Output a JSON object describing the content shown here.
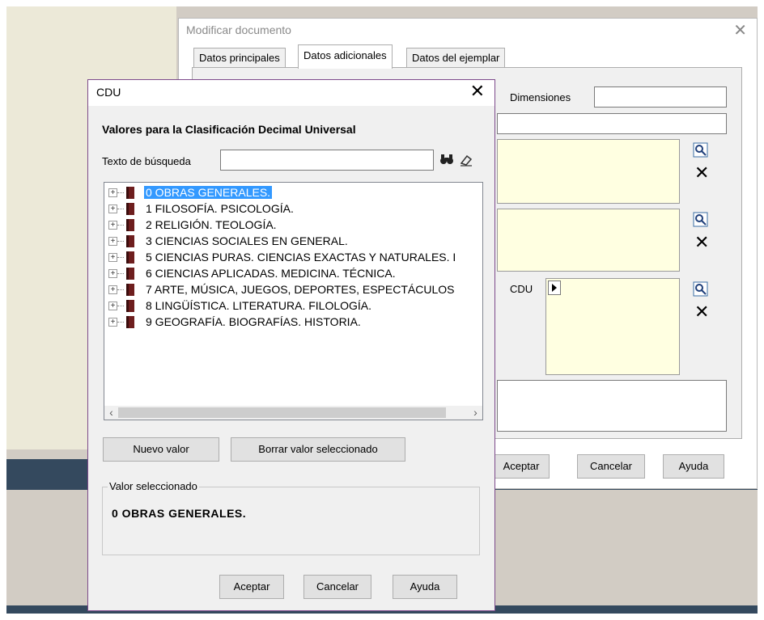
{
  "back_window": {
    "title": "Modificar documento",
    "tabs": [
      "Datos principales",
      "Datos adicionales",
      "Datos del ejemplar"
    ],
    "dimensions_label": "Dimensiones",
    "cdu_label": "CDU",
    "buttons": {
      "accept": "Aceptar",
      "cancel": "Cancelar",
      "help": "Ayuda"
    }
  },
  "dialog": {
    "title": "CDU",
    "heading": "Valores para la Clasificación Decimal Universal",
    "search_label": "Texto de búsqueda",
    "search_value": "",
    "tree": [
      "0  OBRAS GENERALES.",
      "1  FILOSOFÍA. PSICOLOGÍA.",
      "2  RELIGIÓN. TEOLOGÍA.",
      "3  CIENCIAS SOCIALES EN GENERAL.",
      "5  CIENCIAS PURAS. CIENCIAS EXACTAS Y NATURALES. I",
      "6  CIENCIAS APLICADAS. MEDICINA. TÉCNICA.",
      "7  ARTE, MÚSICA, JUEGOS, DEPORTES, ESPECTÁCULOS",
      "8  LINGÜÍSTICA. LITERATURA. FILOLOGÍA.",
      "9  GEOGRAFÍA. BIOGRAFÍAS. HISTORIA."
    ],
    "selected_index": 0,
    "new_value_button": "Nuevo valor",
    "delete_button": "Borrar valor seleccionado",
    "selected_group_label": "Valor seleccionado",
    "selected_value": "0  OBRAS GENERALES.",
    "buttons": {
      "accept": "Aceptar",
      "cancel": "Cancelar",
      "help": "Ayuda"
    }
  }
}
